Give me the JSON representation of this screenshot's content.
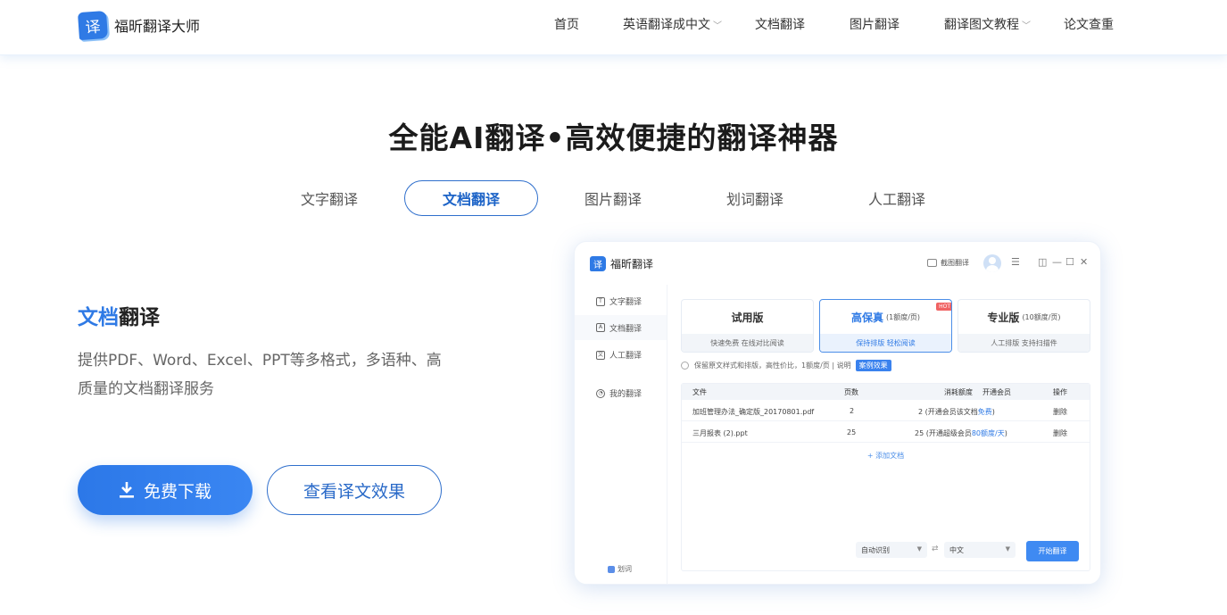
{
  "brand": {
    "name": "福昕翻译大师",
    "icon_char": "译"
  },
  "nav": [
    {
      "label": "首页"
    },
    {
      "label": "英语翻译成中文",
      "dropdown": true
    },
    {
      "label": "文档翻译"
    },
    {
      "label": "图片翻译"
    },
    {
      "label": "翻译图文教程",
      "dropdown": true
    },
    {
      "label": "论文查重"
    }
  ],
  "hero": {
    "title": "全能AI翻译•高效便捷的翻译神器",
    "tabs": [
      "文字翻译",
      "文档翻译",
      "图片翻译",
      "划词翻译",
      "人工翻译"
    ],
    "active_tab": "文档翻译"
  },
  "feature": {
    "title_highlight": "文档",
    "title_rest": "翻译",
    "desc": "提供PDF、Word、Excel、PPT等多格式，多语种、高质量的文档翻译服务",
    "download_label": "免费下载",
    "view_label": "查看译文效果"
  },
  "app": {
    "name": "福昕翻译",
    "logo_char": "译",
    "screenshot_label": "截图翻译",
    "sidebar": [
      "文字翻译",
      "文档翻译",
      "人工翻译",
      "我的翻译"
    ],
    "sidebar_icons": [
      "T",
      "A",
      "文",
      "◔"
    ],
    "sidebar_bottom": "划词",
    "cards": [
      {
        "title": "试用版",
        "sub": "",
        "desc": "快速免费 在线对比阅读"
      },
      {
        "title": "高保真",
        "sub": "(1额度/页)",
        "desc": "保持排版 轻松阅读",
        "badge": "HOT"
      },
      {
        "title": "专业版",
        "sub": "(10额度/页)",
        "desc": "人工排版 支持扫描件"
      }
    ],
    "option_text": "保留原文样式和排版，高性价比，1额度/页 | 说明",
    "option_tag": "案例效果",
    "table": {
      "headers": {
        "file": "文件",
        "pages": "页数",
        "quota": "消耗额度",
        "vip": "开通会员",
        "action": "操作"
      },
      "rows": [
        {
          "file": "加班管理办法_确定版_20170801.pdf",
          "pages": "2",
          "quota": "2 (开通会员该文档",
          "quota_link": "免费",
          "quota_end": ")",
          "action": "删除"
        },
        {
          "file": "三月报表 (2).ppt",
          "pages": "25",
          "quota": "25 (开通超级会员",
          "quota_link": "80额度/天",
          "quota_end": ")",
          "action": "删除"
        }
      ],
      "add_label": "+ 添加文档"
    },
    "source_lang": "自动识别",
    "target_lang": "中文",
    "start_label": "开始翻译"
  }
}
